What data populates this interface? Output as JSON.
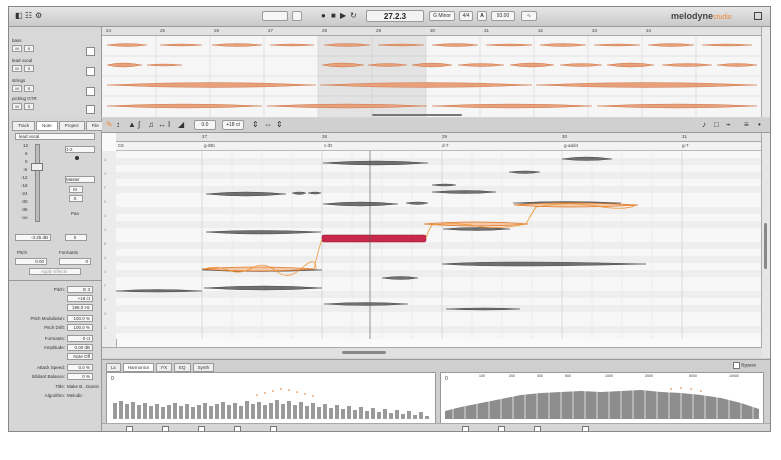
{
  "toolbar": {
    "position": "27.2.3",
    "key": "G Minor",
    "meter": "4/4",
    "tempo_label": "A",
    "tempo": "93.00",
    "logo_main": "melodyne",
    "logo_sub": "studio"
  },
  "overview": {
    "tracks": [
      {
        "name": "bass"
      },
      {
        "name": "lead vocal"
      },
      {
        "name": "strings"
      },
      {
        "name": "picking GTR"
      }
    ],
    "bar_numbers": [
      "24",
      "25",
      "26",
      "27",
      "28",
      "29",
      "30",
      "31",
      "32",
      "33",
      "34"
    ]
  },
  "inspector": {
    "tabs": [
      {
        "label": "Track"
      },
      {
        "label": "Note"
      },
      {
        "label": "Project"
      },
      {
        "label": "File"
      }
    ],
    "header": "lead vocal",
    "levels": [
      "12",
      "6",
      "0",
      "-6",
      "-12",
      "-18",
      "-24",
      "-30",
      "-36",
      "-oo"
    ],
    "master_label": "Master",
    "m_label": "M",
    "s_label": "S",
    "pan_label": "Pan",
    "gain": "-3.25 dB",
    "pan": "0",
    "pitch_label": "Pitch",
    "formants_label": "Formants",
    "pitch_value": "0.00",
    "formants_value": "0",
    "apply_effects": "Apply Effects",
    "note_params": [
      {
        "label": "Pitch:",
        "value": "G 3"
      },
      {
        "label": "",
        "value": "+18 ct"
      },
      {
        "label": "",
        "value": "196.0 Hz"
      },
      {
        "label": "Pitch Modulation:",
        "value": "100.0 %"
      },
      {
        "label": "Pitch Drift:",
        "value": "100.0 %"
      },
      {
        "label": "Formants:",
        "value": "0 ct"
      },
      {
        "label": "Amplitude:",
        "value": "0.00 dB"
      },
      {
        "label": "",
        "value": "Note Off"
      },
      {
        "label": "Attack Speed:",
        "value": "0.0 %"
      },
      {
        "label": "Sibilant Balance:",
        "value": "0 %"
      },
      {
        "label": "Title:",
        "value": "Make B...Damin"
      },
      {
        "label": "Algorithm:",
        "value": "Melodic"
      }
    ]
  },
  "editor": {
    "zoom": "0.0",
    "cent": "+18 ct",
    "bar_numbers": [
      "27",
      "28",
      "29",
      "30",
      "31",
      "32"
    ],
    "chords": [
      "C6",
      "g-/Bb",
      "c-/D",
      "d-7",
      "g-add4",
      "g-7"
    ]
  },
  "bottom": {
    "tabs": [
      {
        "label": "Lx"
      },
      {
        "label": "Harmonics"
      },
      {
        "label": "FX"
      },
      {
        "label": "EQ"
      },
      {
        "label": "Synth"
      }
    ],
    "bypass": "Bypass",
    "freqs": [
      "100",
      "200",
      "300",
      "500",
      "1000",
      "2000",
      "5000",
      "10000"
    ]
  },
  "colors": {
    "accent": "#f08a3c",
    "selected_note": "#c8284a",
    "note_fill": "#6f6f6f",
    "pitch_curve": "#f0912e"
  }
}
